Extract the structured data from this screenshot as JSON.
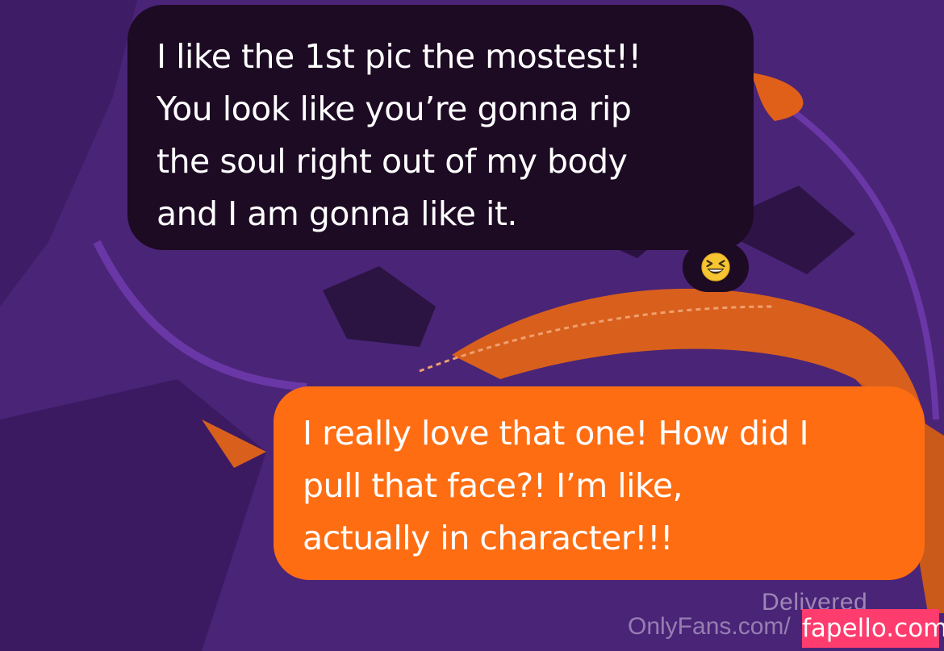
{
  "conversation": {
    "received_message": {
      "lines": [
        "I like the 1st pic the mostest!!",
        "You look like you’re gonna rip",
        "the soul right out of my body",
        "and I am gonna like it."
      ]
    },
    "reaction": {
      "emoji_icon": "grinning-squinting-face-icon"
    },
    "sent_message": {
      "lines": [
        "I really love that one! How did I",
        "pull that face?! I’m like,",
        "actually in character!!!"
      ],
      "color": "#ff6d12"
    },
    "status": "Delivered"
  },
  "watermarks": {
    "onlyfans": "OnlyFans.com/",
    "fapello": "fapello.com"
  },
  "colors": {
    "background": "#4a2477",
    "received_bubble": "#1d0a23",
    "sent_bubble": "#ff6d12",
    "accent_orange": "#ff6d12",
    "watermark_pink": "#ff3c6e"
  }
}
